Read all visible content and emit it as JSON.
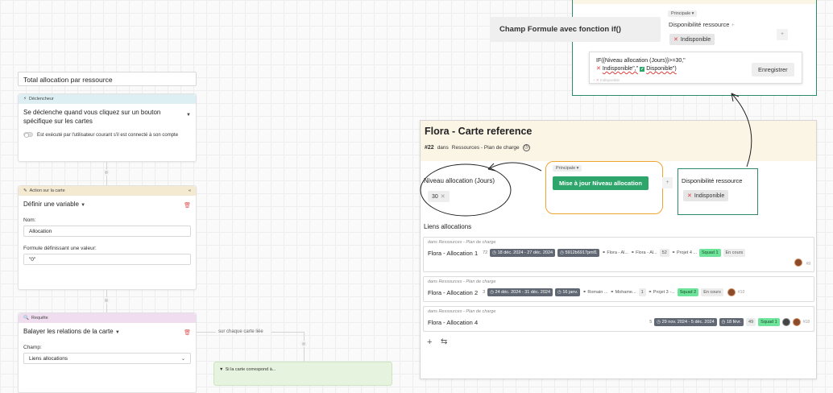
{
  "automation": {
    "title": "Total allocation par ressource",
    "trigger": {
      "header": "Déclencheur",
      "select_text": "Se déclenche quand vous cliquez sur un bouton spécifique sur les cartes",
      "toggle_text": "Est exécuté par l'utilisateur courant s'il est connecté à son compte"
    },
    "action": {
      "header": "Action sur la carte",
      "select_text": "Définir une variable",
      "name_label": "Nom:",
      "name_value": "Allocation",
      "formula_label": "Formule définissant une valeur:",
      "formula_value": "\"0\""
    },
    "query": {
      "header": "Requête",
      "select_text": "Balayer les relations de la carte",
      "field_label": "Champ:",
      "field_value": "Liens allocations",
      "each_label": "sur chaque carte liée",
      "condition_label": "Si la carte correspond à..."
    }
  },
  "card": {
    "title": "Flora - Carte reference",
    "number": "#22",
    "in_label": "dans",
    "breadcrumb": "Ressources - Plan de charge",
    "niveau_label": "Niveau allocation (Jours)",
    "niveau_value": "30",
    "principale_tag": "Principale",
    "update_button": "Mise à jour Niveau allocation",
    "plus": "+",
    "dispo_label": "Disponibilité ressource",
    "dispo_value": "Indisponible",
    "liens_label": "Liens allocations",
    "rows": [
      {
        "pre": "dans Ressources - Plan de charge",
        "title": "Flora - Allocation 1",
        "num": "72",
        "dates": "18 déc. 2024 - 27 déc. 2024",
        "extra": "5912b6917pmf1",
        "link1": "Flora - Al...",
        "link2": "Flora - Al...",
        "n2": "52",
        "link3": "Projet 4 ...",
        "squad": "Squad 1",
        "status": "En cours",
        "id": "#9"
      },
      {
        "pre": "dans Ressources - Plan de charge",
        "title": "Flora - Allocation 2",
        "num": "3",
        "dates": "24 déc. 2024 - 31 déc. 2024",
        "extra": "16 janv.",
        "link1": "Romain ...",
        "link2": "Mohame...",
        "n2": "1",
        "link3": "Projet 3 -...",
        "squad": "Squad 2",
        "status": "En cours",
        "id": "#10"
      },
      {
        "pre": "dans Ressources - Plan de charge",
        "title": "Flora - Allocation 4",
        "num": "5",
        "dates": "29 nov. 2024 - 5 déc. 2024",
        "extra": "18 févr.",
        "n2": "49",
        "squad": "Squad 1",
        "id": "#18"
      }
    ]
  },
  "popup": {
    "formula_title": "Champ Formule avec fonction if()",
    "principale_tag": "Principale",
    "dispo_label": "Disponibilité ressource",
    "dispo_value": "Indisponible",
    "formula_line1": "IF({Niveau allocation (Jours)}>=30,\"",
    "formula_line2a": "Indisponible\",\"",
    "formula_line2b": "Disponible\")",
    "save_button": "Enregistrer",
    "preview": "Indisponible",
    "plus": "+"
  },
  "colors": {
    "accent_green": "#2ea56b",
    "popup_border": "#2d8a6b",
    "orange_outline": "#f0a531",
    "teal_outline": "#2d8a6b"
  }
}
